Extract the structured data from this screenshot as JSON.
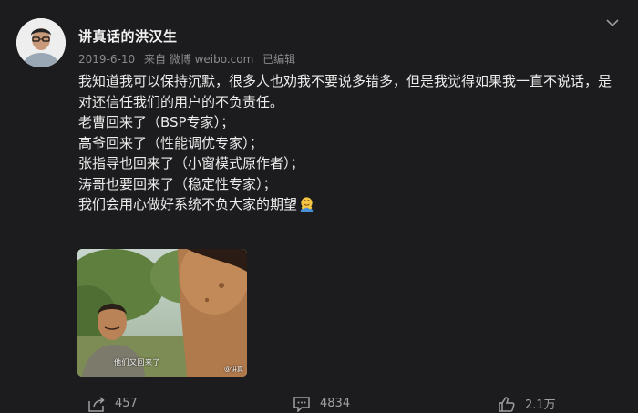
{
  "post": {
    "author": "讲真话的洪汉生",
    "date": "2019-6-10",
    "source": "来自 微博 weibo.com",
    "edited": "已编辑",
    "lines": [
      "我知道我可以保持沉默，很多人也劝我不要说多错多，但是我觉得如果我一直不说话，是对还信任我们的用户的不负责任。",
      "老曹回来了（BSP专家）；",
      "高爷回来了（性能调优专家）；",
      "张指导也回来了（小窗模式原作者）；",
      "涛哥也要回来了（稳定性专家）；",
      "我们会用心做好系统不负大家的期望"
    ],
    "emoji": "hug-emoji",
    "image": {
      "subtitle": "他们又回来了",
      "watermark": "@讲真"
    }
  },
  "actions": {
    "repost_count": "457",
    "comment_count": "4834",
    "like_count": "2.1万"
  },
  "icons": {
    "more": "chevron-down-icon",
    "repost": "share-icon",
    "comment": "comment-icon",
    "like": "thumbs-up-icon"
  },
  "colors": {
    "background": "#1c1c1e",
    "text": "#ececec",
    "muted": "#8a8a8e"
  }
}
